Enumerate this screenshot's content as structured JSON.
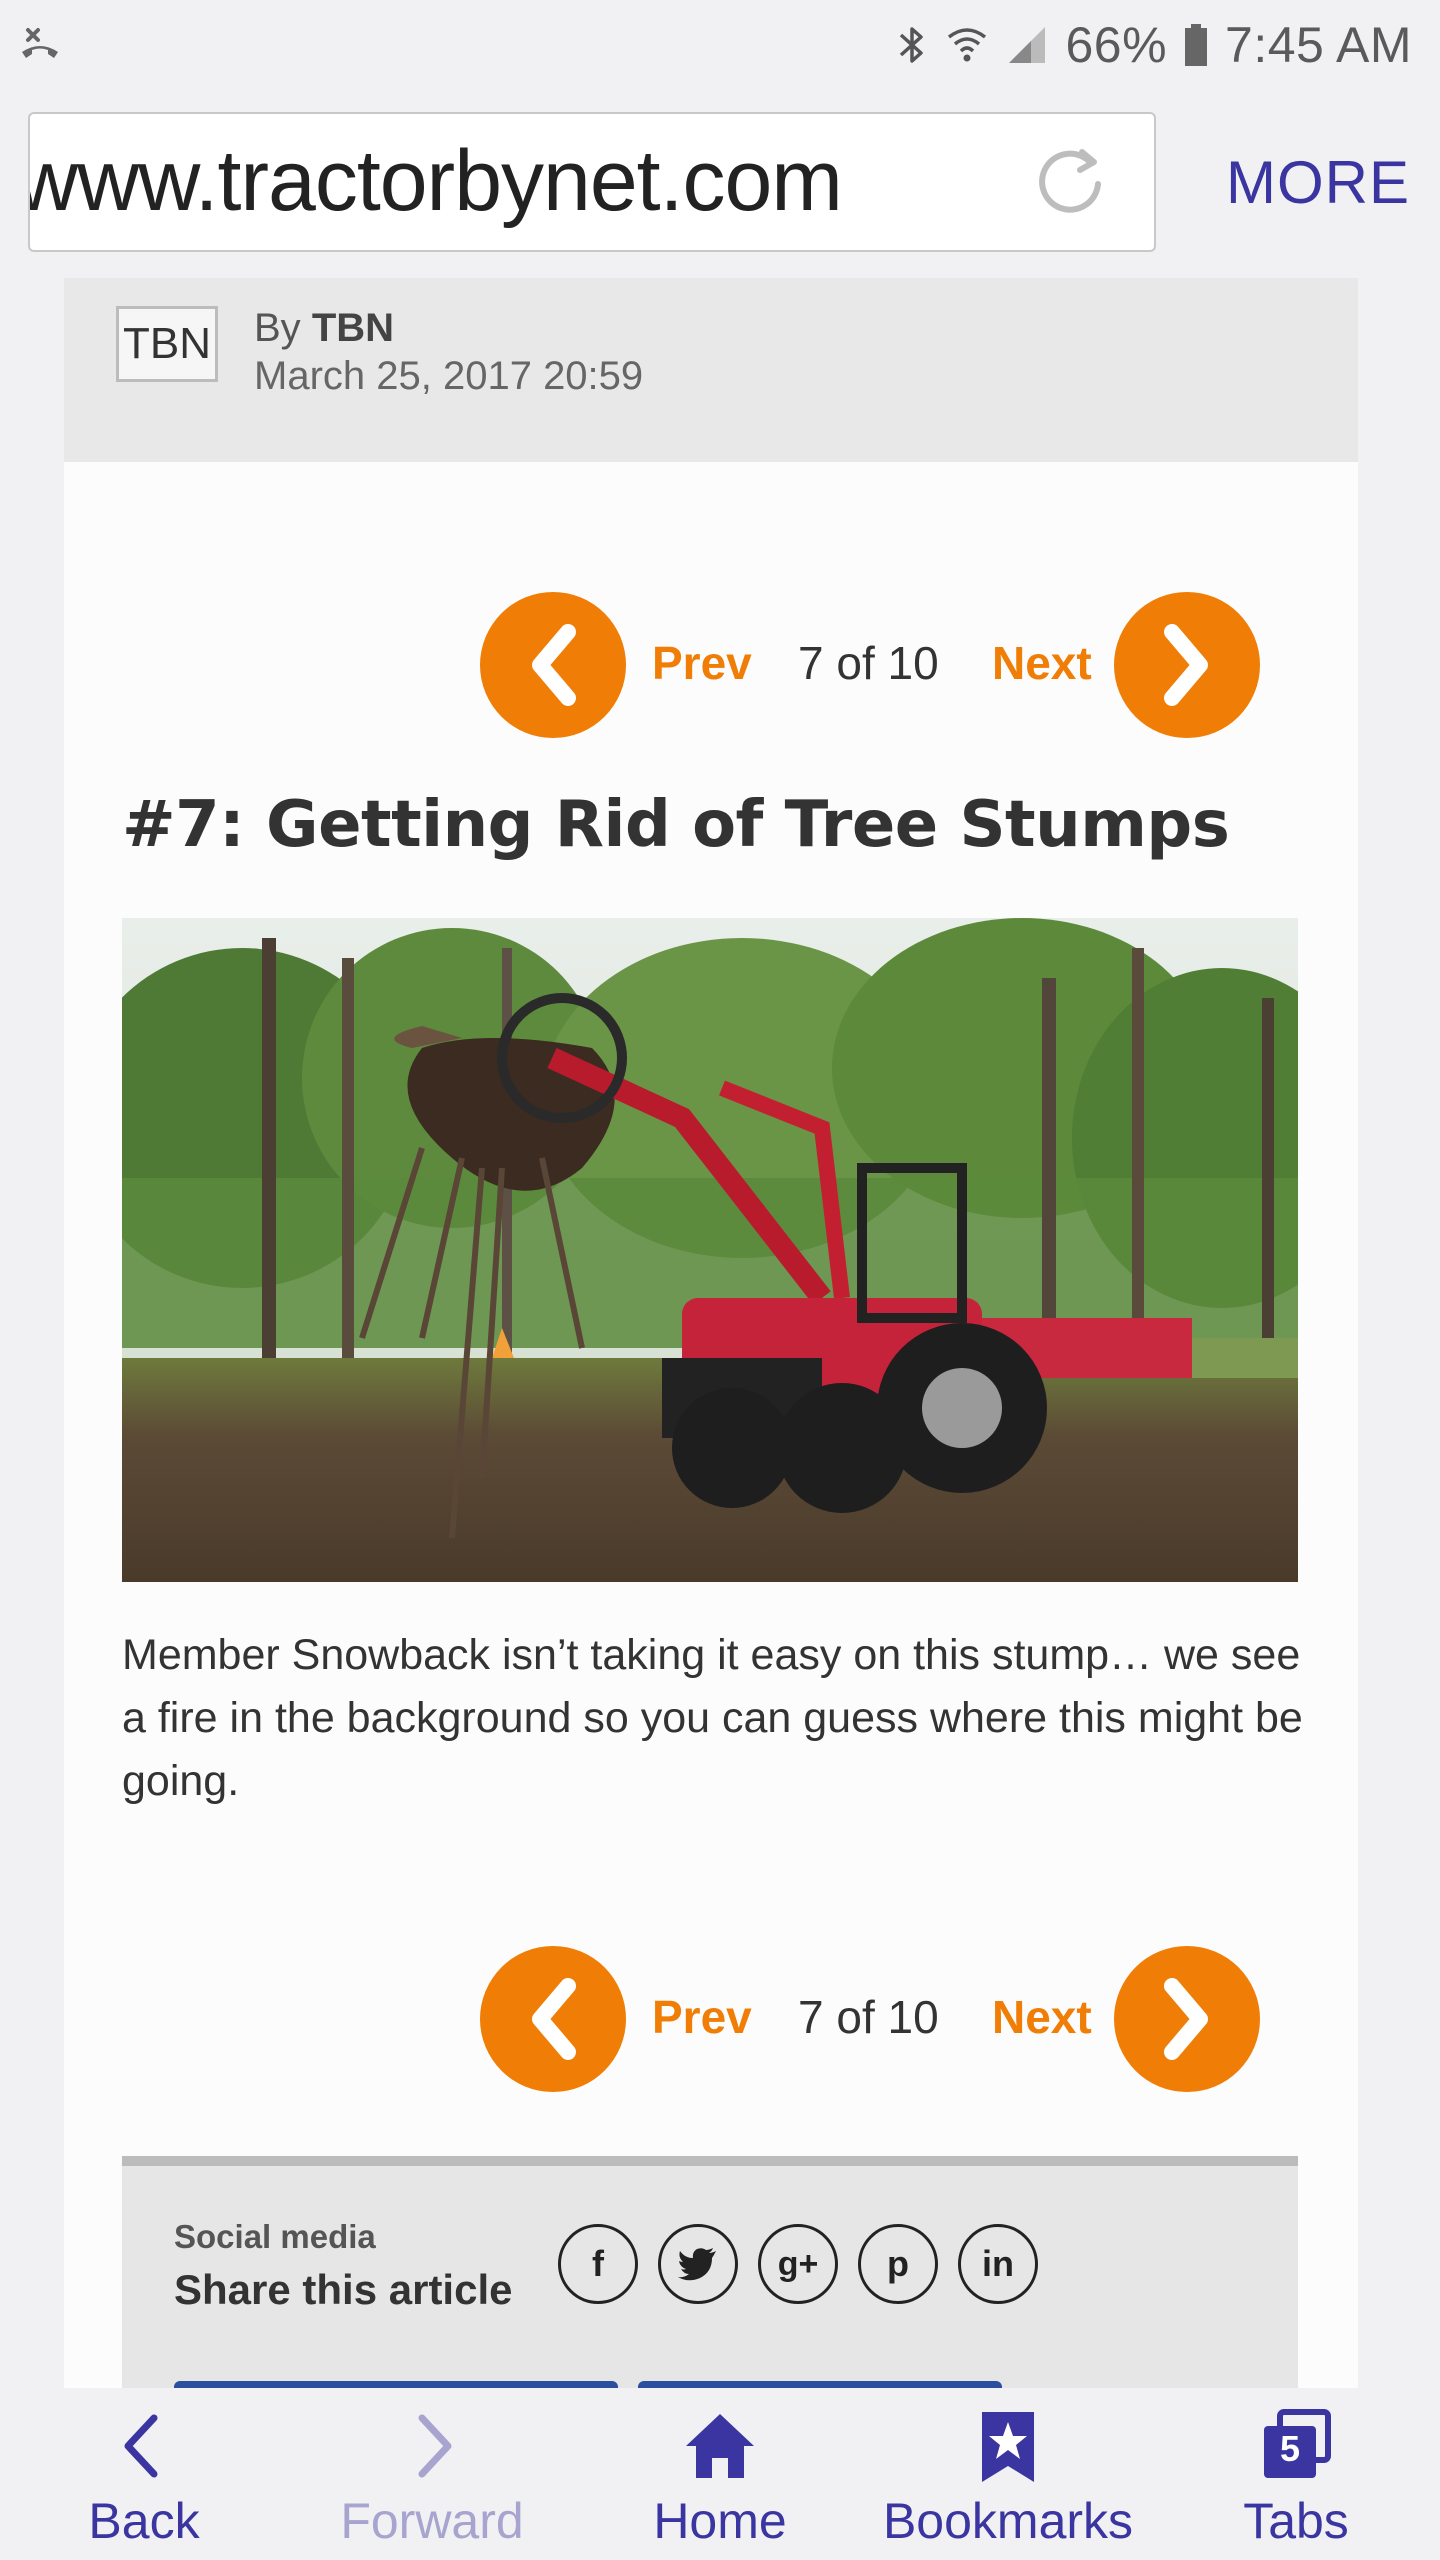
{
  "status": {
    "battery": "66%",
    "time": "7:45 AM"
  },
  "browser": {
    "url": "www.tractorbynet.com",
    "more_label": "MORE"
  },
  "article": {
    "author_avatar": "TBN",
    "by_prefix": "By",
    "author": "TBN",
    "date": "March 25, 2017 20:59",
    "pager": {
      "prev_label": "Prev",
      "next_label": "Next",
      "count": "7 of 10"
    },
    "title": "#7: Getting Rid of Tree Stumps",
    "caption": "Member Snowback isn’t taking it easy on this stump… we see a fire in the background so you can guess where this might be going.",
    "share": {
      "small_label": "Social media",
      "big_label": "Share this article",
      "networks": [
        "f",
        "twitter",
        "g+",
        "p",
        "in"
      ]
    }
  },
  "bottom_nav": {
    "back": "Back",
    "forward": "Forward",
    "home": "Home",
    "bookmarks": "Bookmarks",
    "tabs": "Tabs",
    "tabs_count": "5"
  },
  "colors": {
    "accent_orange": "#f07d05",
    "browser_purple": "#3a35a0"
  }
}
